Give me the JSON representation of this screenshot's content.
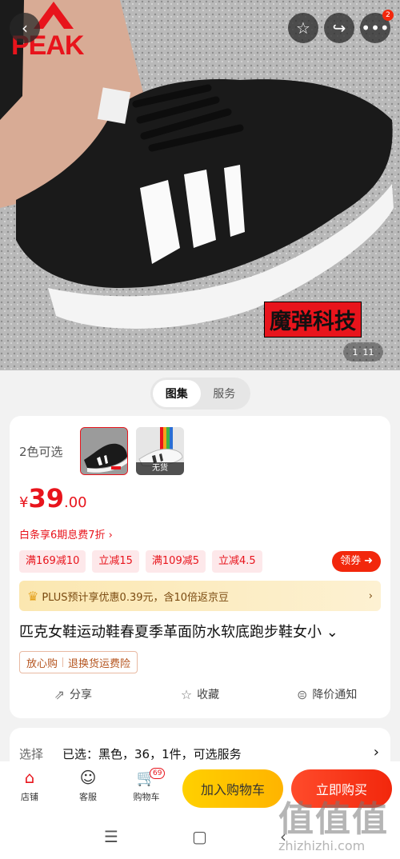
{
  "hero": {
    "brand": "PEAK",
    "tech_label": "魔弹科技",
    "page_current": "1",
    "page_total": "11",
    "share_badge": "2",
    "icons": [
      "back-icon",
      "star-icon",
      "share-icon",
      "more-icon"
    ]
  },
  "tabs": [
    {
      "label": "图集",
      "active": true
    },
    {
      "label": "服务",
      "active": false
    }
  ],
  "product": {
    "colors_label": "2色可选",
    "thumb_tag": "无货",
    "price": {
      "currency": "¥",
      "integer": "39",
      "decimal": ".00"
    },
    "baitiao": "白条享6期息费7折 ›",
    "coupons": [
      "满169减10",
      "立减15",
      "满109减5",
      "立减4.5"
    ],
    "coupon_button": "领券",
    "plus_text": "PLUS预计享优惠0.39元，含10倍返京豆",
    "title": "匹克女鞋运动鞋春夏季革面防水软底跑步鞋女小",
    "guarantee": [
      "放心购",
      "退换货运费险"
    ],
    "actions": [
      {
        "icon": "share-icon",
        "label": "分享"
      },
      {
        "icon": "star-icon",
        "label": "收藏"
      },
      {
        "icon": "price-alert-icon",
        "label": "降价通知"
      }
    ]
  },
  "select": {
    "label": "选择",
    "value": "已选：黑色，36，1件，可选服务"
  },
  "bottom_bar": {
    "store": "店铺",
    "service": "客服",
    "cart": "购物车",
    "cart_count": "69",
    "add_to_cart": "加入购物车",
    "buy_now": "立即购买"
  },
  "watermark": {
    "big": "值值值",
    "small": "zhizhizhi.com"
  },
  "colors": {
    "accent": "#e8141c",
    "buy": "#f2270c",
    "cart": "#ffc400",
    "plus": "#fbe7b0"
  }
}
